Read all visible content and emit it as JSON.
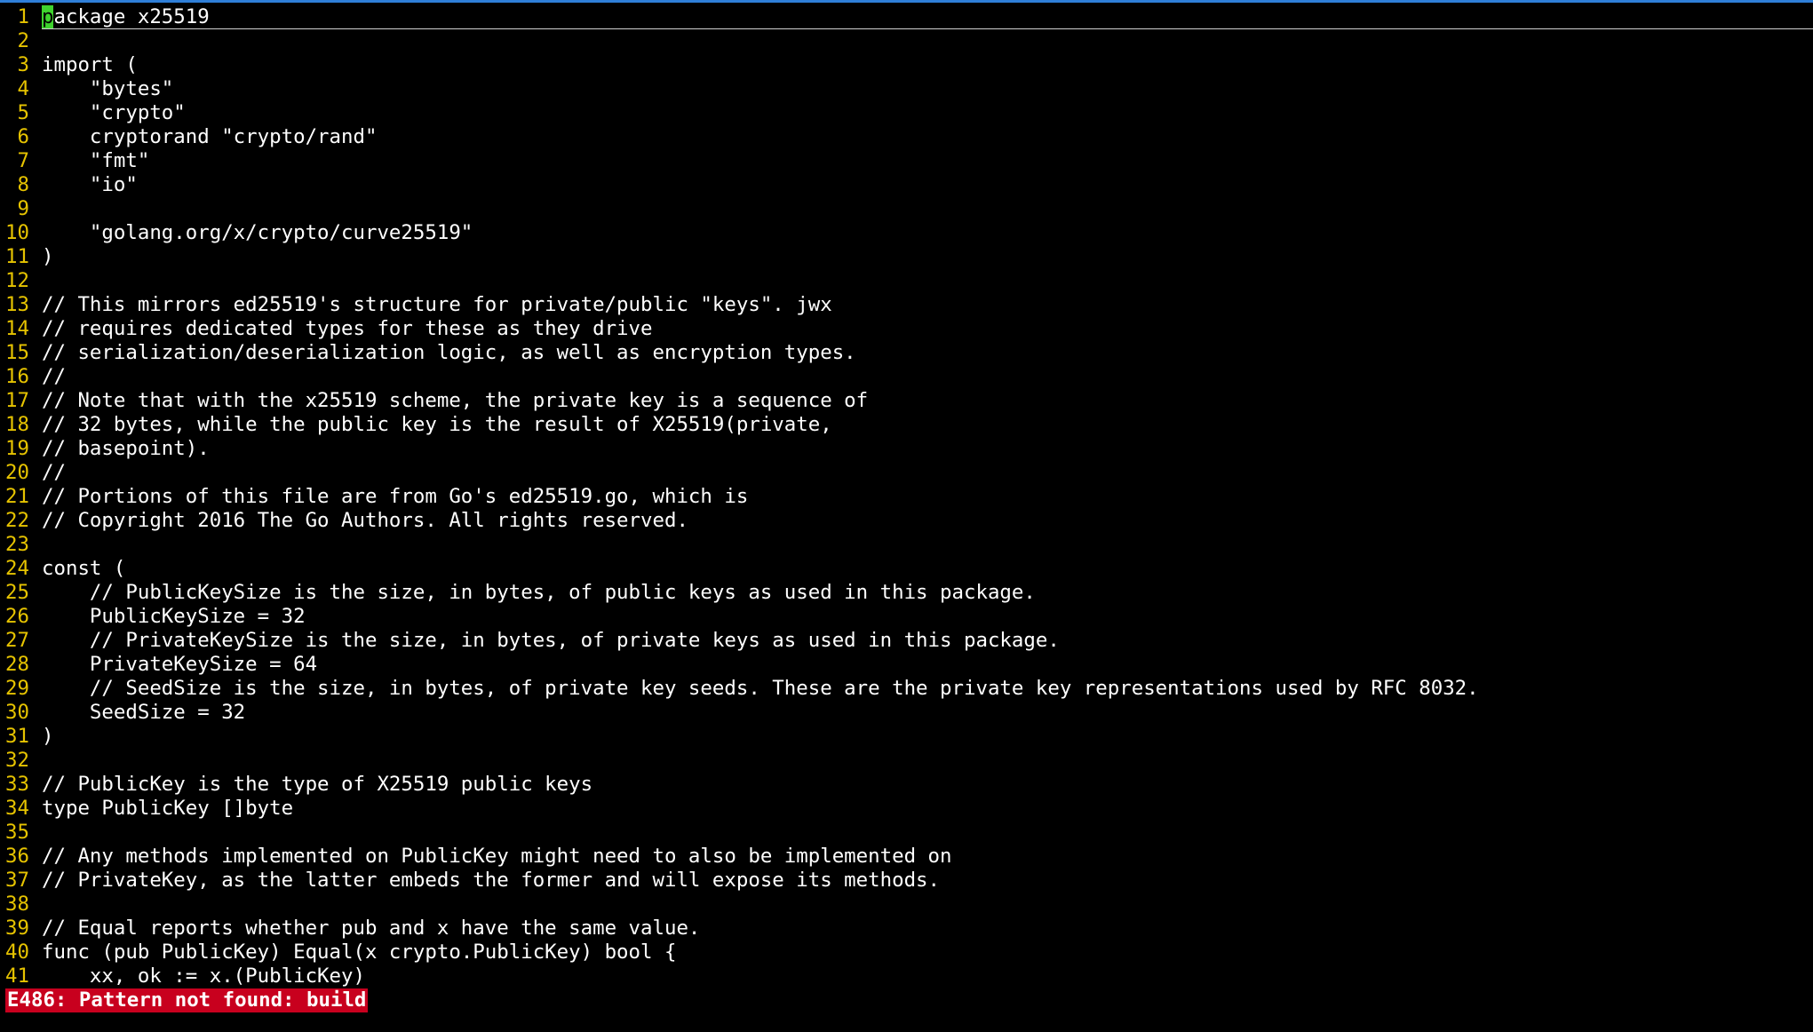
{
  "editor": {
    "cursor_line_first_char": "p",
    "cursor_line_rest": "ackage x25519",
    "lines": [
      {
        "num": "1",
        "text": "package x25519"
      },
      {
        "num": "2",
        "text": ""
      },
      {
        "num": "3",
        "text": "import ("
      },
      {
        "num": "4",
        "text": "    \"bytes\""
      },
      {
        "num": "5",
        "text": "    \"crypto\""
      },
      {
        "num": "6",
        "text": "    cryptorand \"crypto/rand\""
      },
      {
        "num": "7",
        "text": "    \"fmt\""
      },
      {
        "num": "8",
        "text": "    \"io\""
      },
      {
        "num": "9",
        "text": ""
      },
      {
        "num": "10",
        "text": "    \"golang.org/x/crypto/curve25519\""
      },
      {
        "num": "11",
        "text": ")"
      },
      {
        "num": "12",
        "text": ""
      },
      {
        "num": "13",
        "text": "// This mirrors ed25519's structure for private/public \"keys\". jwx"
      },
      {
        "num": "14",
        "text": "// requires dedicated types for these as they drive"
      },
      {
        "num": "15",
        "text": "// serialization/deserialization logic, as well as encryption types."
      },
      {
        "num": "16",
        "text": "//"
      },
      {
        "num": "17",
        "text": "// Note that with the x25519 scheme, the private key is a sequence of"
      },
      {
        "num": "18",
        "text": "// 32 bytes, while the public key is the result of X25519(private,"
      },
      {
        "num": "19",
        "text": "// basepoint)."
      },
      {
        "num": "20",
        "text": "//"
      },
      {
        "num": "21",
        "text": "// Portions of this file are from Go's ed25519.go, which is"
      },
      {
        "num": "22",
        "text": "// Copyright 2016 The Go Authors. All rights reserved."
      },
      {
        "num": "23",
        "text": ""
      },
      {
        "num": "24",
        "text": "const ("
      },
      {
        "num": "25",
        "text": "    // PublicKeySize is the size, in bytes, of public keys as used in this package."
      },
      {
        "num": "26",
        "text": "    PublicKeySize = 32"
      },
      {
        "num": "27",
        "text": "    // PrivateKeySize is the size, in bytes, of private keys as used in this package."
      },
      {
        "num": "28",
        "text": "    PrivateKeySize = 64"
      },
      {
        "num": "29",
        "text": "    // SeedSize is the size, in bytes, of private key seeds. These are the private key representations used by RFC 8032."
      },
      {
        "num": "30",
        "text": "    SeedSize = 32"
      },
      {
        "num": "31",
        "text": ")"
      },
      {
        "num": "32",
        "text": ""
      },
      {
        "num": "33",
        "text": "// PublicKey is the type of X25519 public keys"
      },
      {
        "num": "34",
        "text": "type PublicKey []byte"
      },
      {
        "num": "35",
        "text": ""
      },
      {
        "num": "36",
        "text": "// Any methods implemented on PublicKey might need to also be implemented on"
      },
      {
        "num": "37",
        "text": "// PrivateKey, as the latter embeds the former and will expose its methods."
      },
      {
        "num": "38",
        "text": ""
      },
      {
        "num": "39",
        "text": "// Equal reports whether pub and x have the same value."
      },
      {
        "num": "40",
        "text": "func (pub PublicKey) Equal(x crypto.PublicKey) bool {"
      },
      {
        "num": "41",
        "text": "    xx, ok := x.(PublicKey)"
      }
    ]
  },
  "cmdline": {
    "message": "E486: Pattern not found: build"
  },
  "colors": {
    "background": "#000000",
    "line_number": "#e6c300",
    "text": "#ffffff",
    "cursor": "#3fd32e",
    "error_bg": "#c8001e",
    "error_fg": "#ffffff",
    "top_accent": "#2f7fd8"
  }
}
